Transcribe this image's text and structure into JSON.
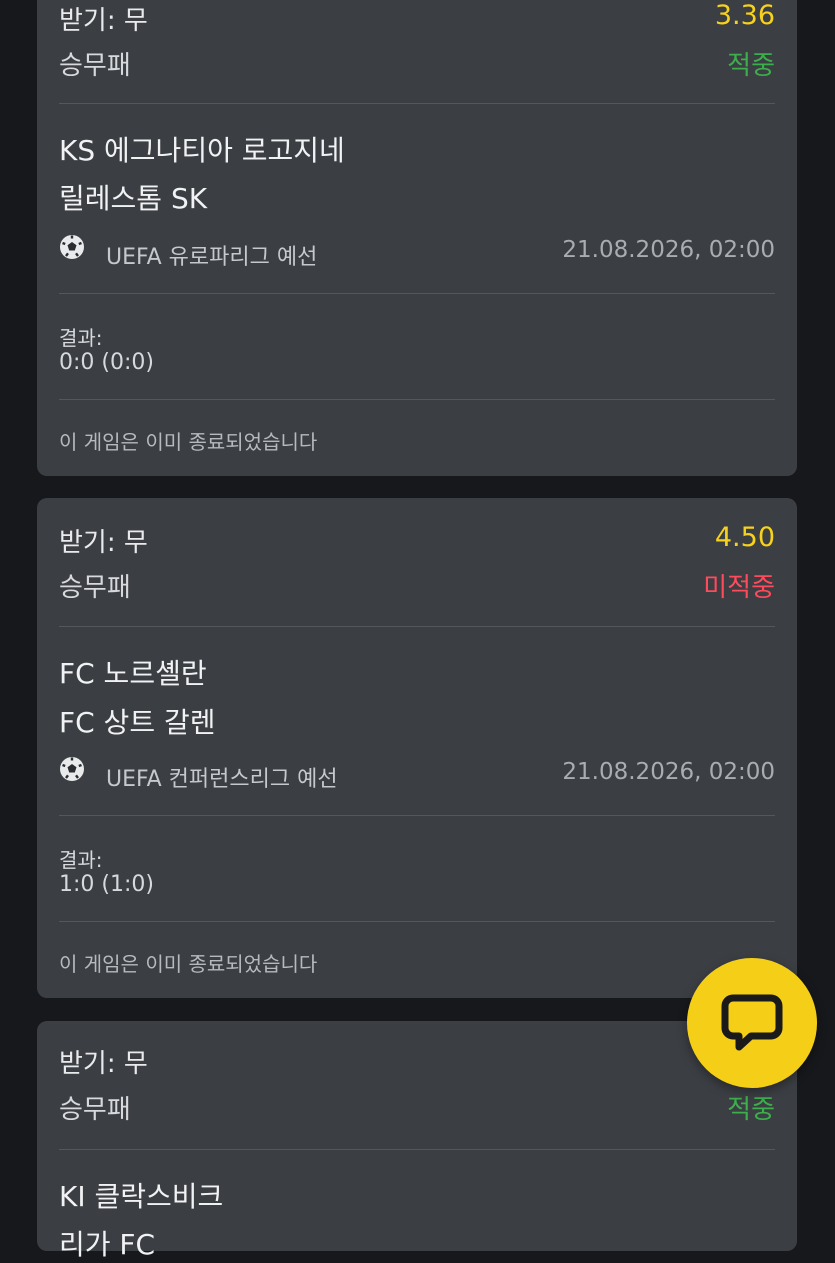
{
  "cards": [
    {
      "pick": "받기: 무",
      "odds": "3.36",
      "market": "승무패",
      "status": "적중",
      "home": "KS 에그나티아 로고지네",
      "away": "릴레스톰 SK",
      "league": "UEFA 유로파리그 예선",
      "datetime": "21.08.2026, 02:00",
      "result_label": "결과:",
      "result": "0:0 (0:0)",
      "note": "이 게임은 이미 종료되었습니다"
    },
    {
      "pick": "받기: 무",
      "odds": "4.50",
      "market": "승무패",
      "status": "미적중",
      "home": "FC 노르셸란",
      "away": "FC 상트 갈렌",
      "league": "UEFA 컨퍼런스리그 예선",
      "datetime": "21.08.2026, 02:00",
      "result_label": "결과:",
      "result": "1:0 (1:0)",
      "note": "이 게임은 이미 종료되었습니다"
    },
    {
      "pick": "받기: 무",
      "market": "승무패",
      "status": "적중",
      "home": "KI 클락스비크",
      "away": "리가 FC"
    }
  ],
  "chat_button": {
    "icon": "chat-bubble-icon"
  },
  "colors": {
    "background": "#16181c",
    "card": "#3b3e43",
    "odds": "#f7d21c",
    "win": "#3cae4b",
    "lose": "#ff4a5b",
    "chat_button": "#f5cf17"
  }
}
